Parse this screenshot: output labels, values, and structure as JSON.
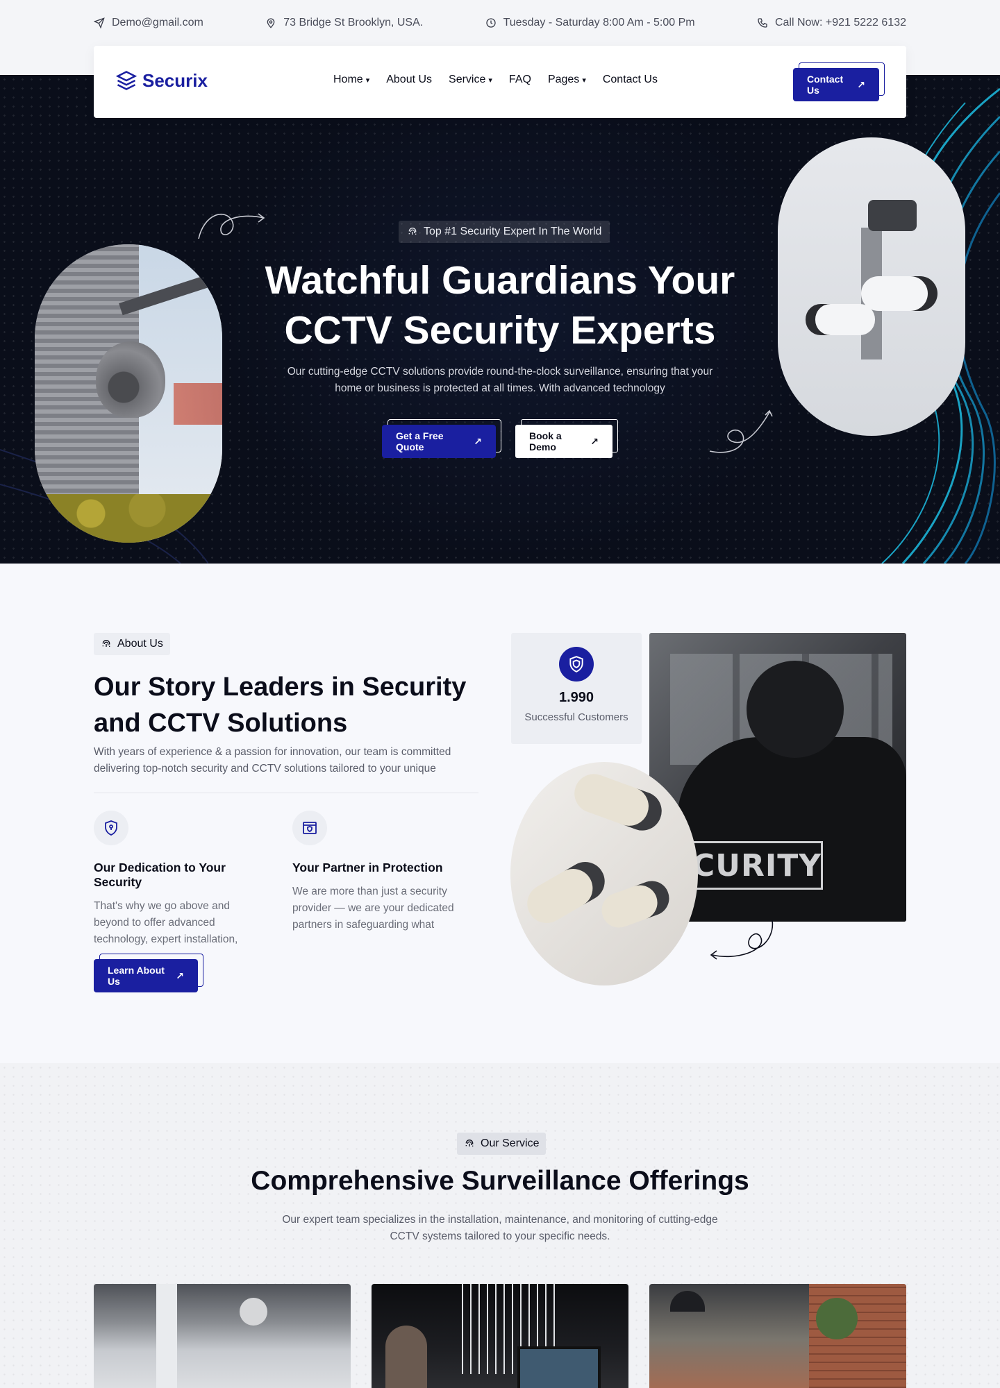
{
  "topbar": {
    "email": "Demo@gmail.com",
    "address": "73 Bridge St Brooklyn, USA.",
    "hours": "Tuesday - Saturday 8:00 Am - 5:00 Pm",
    "phone": "Call Now: +921 5222 6132"
  },
  "nav": {
    "logo": "Securix",
    "items": [
      {
        "label": "Home",
        "dropdown": true
      },
      {
        "label": "About Us",
        "dropdown": false
      },
      {
        "label": "Service",
        "dropdown": true
      },
      {
        "label": "FAQ",
        "dropdown": false
      },
      {
        "label": "Pages",
        "dropdown": true
      },
      {
        "label": "Contact Us",
        "dropdown": false
      }
    ],
    "cta": "Contact Us"
  },
  "hero": {
    "badge": "Top #1 Security Expert In The World",
    "title_line1": "Watchful Guardians Your",
    "title_line2": "CCTV Security Experts",
    "subtitle": "Our cutting-edge CCTV solutions provide round-the-clock surveillance, ensuring that your home or business is protected at all times. With advanced technology",
    "btn_quote": "Get a Free Quote",
    "btn_demo": "Book a Demo"
  },
  "about": {
    "chip": "About Us",
    "title": "Our Story Leaders in Security and CCTV Solutions",
    "text": "With years of experience & a passion for innovation, our team is committed delivering top-notch security and CCTV solutions tailored to your unique",
    "features": [
      {
        "title": "Our Dedication to Your Security",
        "text": "That's why we go above and beyond to offer advanced technology, expert installation,"
      },
      {
        "title": "Your Partner in Protection",
        "text": "We are more than just a security provider — we are your dedicated partners in safeguarding what"
      }
    ],
    "button": "Learn About Us",
    "stat_number": "1.990",
    "stat_label": "Successful Customers",
    "patch_text": "CURITY"
  },
  "service": {
    "chip": "Our Service",
    "title": "Comprehensive Surveillance Offerings",
    "subtitle": "Our expert team specializes in the installation, maintenance, and monitoring of cutting-edge CCTV systems tailored to your specific needs."
  },
  "colors": {
    "brand": "#1a1fa0",
    "hero_bg": "#0a0e1a",
    "accent_lines": "#1aa3c4"
  }
}
